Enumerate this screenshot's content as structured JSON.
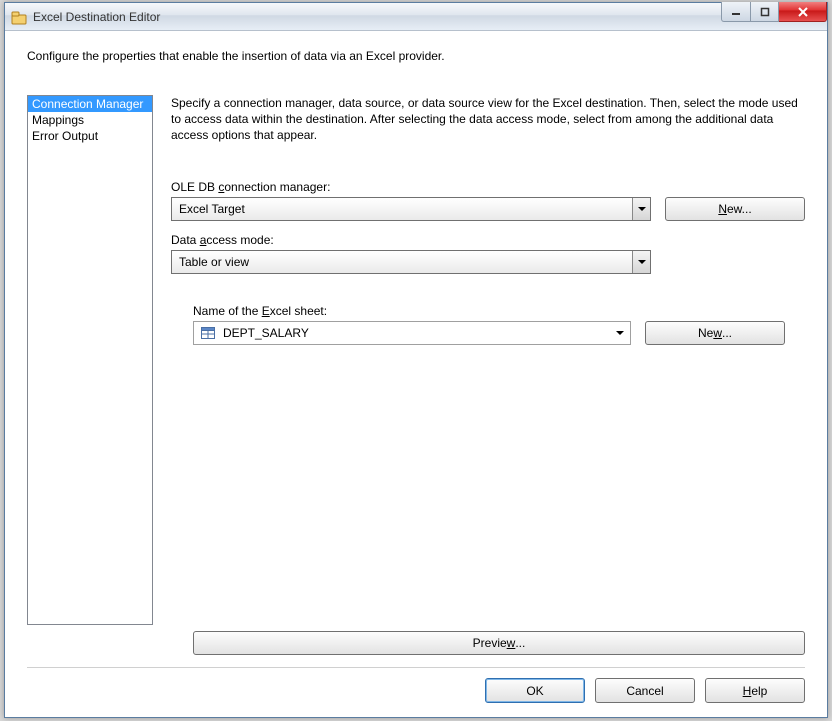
{
  "window": {
    "title": "Excel Destination Editor"
  },
  "intro": "Configure the properties that enable the insertion of data via an Excel provider.",
  "nav": {
    "items": [
      {
        "label": "Connection Manager",
        "selected": true
      },
      {
        "label": "Mappings",
        "selected": false
      },
      {
        "label": "Error Output",
        "selected": false
      }
    ]
  },
  "desc": "Specify a connection manager, data source, or data source view for the Excel destination. Then, select the mode used to access data within the destination. After selecting the data access mode, select from among the additional data access options that appear.",
  "conn": {
    "label_pre": "OLE DB ",
    "label_u": "c",
    "label_post": "onnection manager:",
    "value": "Excel Target",
    "new_pre": "",
    "new_u": "N",
    "new_post": "ew..."
  },
  "mode": {
    "label_pre": "Data ",
    "label_u": "a",
    "label_post": "ccess mode:",
    "value": "Table or view"
  },
  "sheet": {
    "label_pre": "Name of the ",
    "label_u": "E",
    "label_post": "xcel sheet:",
    "value": "DEPT_SALARY",
    "new_pre": "Ne",
    "new_u": "w",
    "new_post": "..."
  },
  "preview": {
    "label_pre": "Previe",
    "label_u": "w",
    "label_post": "..."
  },
  "footer": {
    "ok": "OK",
    "cancel": "Cancel",
    "help_u": "H",
    "help_post": "elp"
  }
}
